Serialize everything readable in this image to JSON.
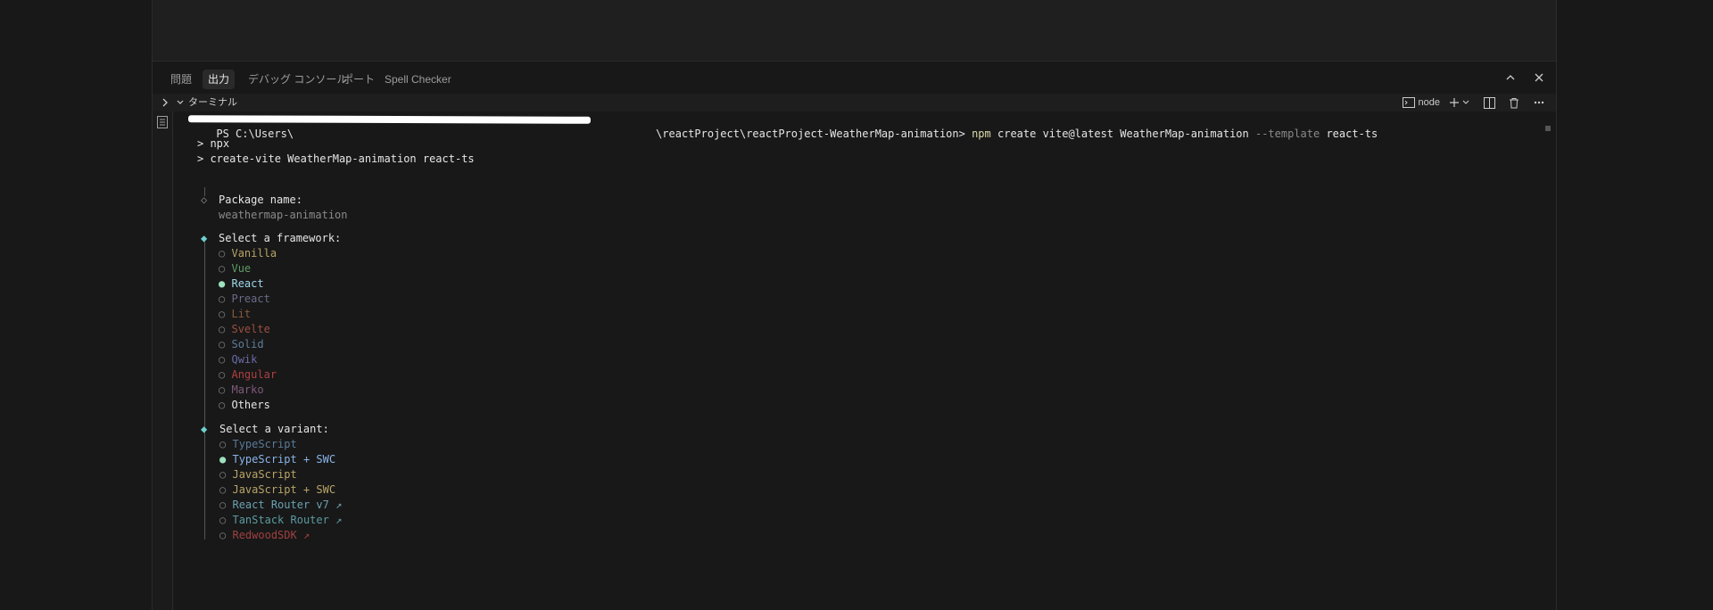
{
  "panel": {
    "tabs": [
      {
        "label": "問題"
      },
      {
        "label": "出力"
      },
      {
        "label": "デバッグ コンソール"
      },
      {
        "label": "ポート"
      },
      {
        "label": "Spell Checker"
      }
    ],
    "active_tab": "出力"
  },
  "terminal_section": {
    "title": "ターミナル",
    "shell_label": "node"
  },
  "terminal": {
    "command_line": {
      "prompt_prefix": "PS C:\\Users\\",
      "path_suffix": "\\reactProject\\reactProject-WeatherMap-animation>",
      "cmd_npm": "npm",
      "cmd_rest1": " create vite@latest WeatherMap-animation ",
      "cmd_flag": "--template",
      "cmd_rest2": " react-ts"
    },
    "npx_line1": "> npx",
    "npx_line2": "> create-vite WeatherMap-animation react-ts",
    "package_prompt": "Package name:",
    "package_value": "weathermap-animation",
    "framework_prompt": "Select a framework:",
    "frameworks": [
      {
        "bullet": "○",
        "label": "Vanilla"
      },
      {
        "bullet": "○",
        "label": "Vue"
      },
      {
        "bullet": "●",
        "label": "React"
      },
      {
        "bullet": "○",
        "label": "Preact"
      },
      {
        "bullet": "○",
        "label": "Lit"
      },
      {
        "bullet": "○",
        "label": "Svelte"
      },
      {
        "bullet": "○",
        "label": "Solid"
      },
      {
        "bullet": "○",
        "label": "Qwik"
      },
      {
        "bullet": "○",
        "label": "Angular"
      },
      {
        "bullet": "○",
        "label": "Marko"
      },
      {
        "bullet": "○",
        "label": "Others"
      }
    ],
    "variant_prompt": "Select a variant:",
    "variants": [
      {
        "bullet": "○",
        "label": "TypeScript"
      },
      {
        "bullet": "●",
        "label": "TypeScript + SWC"
      },
      {
        "bullet": "○",
        "label": "JavaScript"
      },
      {
        "bullet": "○",
        "label": "JavaScript + SWC"
      },
      {
        "bullet": "○",
        "label": "React Router v7 ↗"
      },
      {
        "bullet": "○",
        "label": "TanStack Router ↗"
      },
      {
        "bullet": "○",
        "label": "RedwoodSDK ↗"
      }
    ]
  }
}
